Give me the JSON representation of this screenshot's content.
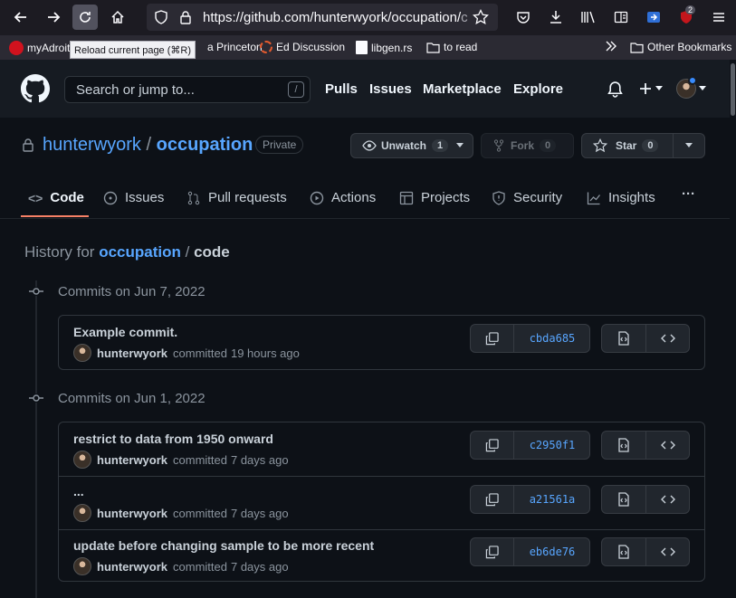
{
  "browser": {
    "url_main": "https://github.com/hunterwyork/occupation/",
    "url_tail": "c",
    "tooltip": "Reload current page (⌘R)",
    "notification_badge": "2",
    "bookmarks": [
      "myAdroit",
      "a Princeton",
      "Ed Discussion",
      "libgen.rs",
      "to read"
    ],
    "other_bookmarks": "Other Bookmarks"
  },
  "header": {
    "search_placeholder": "Search or jump to...",
    "search_key": "/",
    "nav": [
      "Pulls",
      "Issues",
      "Marketplace",
      "Explore"
    ]
  },
  "repo": {
    "owner": "hunterwyork",
    "separator": "/",
    "name": "occupation",
    "visibility": "Private",
    "unwatch_label": "Unwatch",
    "watch_count": "1",
    "fork_label": "Fork",
    "fork_count": "0",
    "star_label": "Star",
    "star_count": "0",
    "tabs": [
      "Code",
      "Issues",
      "Pull requests",
      "Actions",
      "Projects",
      "Security",
      "Insights"
    ],
    "more": "···"
  },
  "history": {
    "prefix": "History for",
    "repo_link": "occupation",
    "separator": "/",
    "path": "code"
  },
  "groups": [
    {
      "date": "Commits on Jun 7, 2022",
      "commits": [
        {
          "message": "Example commit.",
          "author": "hunterwyork",
          "action": "committed",
          "when": "19 hours ago",
          "sha": "cbda685"
        }
      ]
    },
    {
      "date": "Commits on Jun 1, 2022",
      "commits": [
        {
          "message": "restrict to data from 1950 onward",
          "author": "hunterwyork",
          "action": "committed",
          "when": "7 days ago",
          "sha": "c2950f1"
        },
        {
          "message": "...",
          "author": "hunterwyork",
          "action": "committed",
          "when": "7 days ago",
          "sha": "a21561a"
        },
        {
          "message": "update before changing sample to be more recent",
          "author": "hunterwyork",
          "action": "committed",
          "when": "7 days ago",
          "sha": "eb6de76"
        }
      ]
    }
  ],
  "colors": {
    "link": "#58a6ff",
    "accent_underline": "#f78166",
    "background": "#0d1117"
  }
}
